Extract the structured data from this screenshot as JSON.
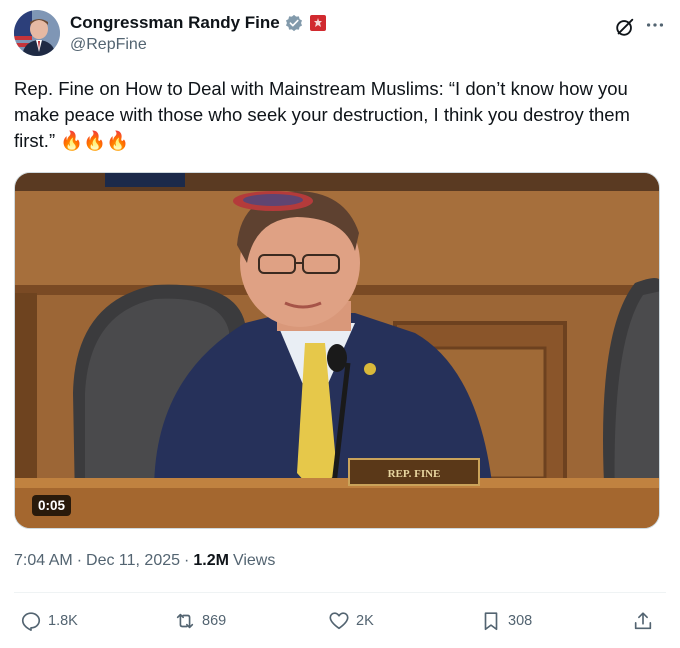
{
  "author": {
    "display_name": "Congressman Randy Fine",
    "handle": "@RepFine"
  },
  "icons": {
    "verified": "verified-badge-icon",
    "affiliate": "house-seal-icon",
    "grok": "grok-icon",
    "more": "more-options-icon"
  },
  "tweet": {
    "text": "Rep. Fine on How to Deal with Mainstream Muslims: “I don’t know how you make peace with those who seek your destruction, I think you destroy them first.” 🔥🔥🔥"
  },
  "media": {
    "nameplate": "REP. FINE",
    "duration": "0:05"
  },
  "meta": {
    "time": "7:04 AM",
    "date": "Dec 11, 2025",
    "views_count": "1.2M",
    "views_label": "Views",
    "separator": "·"
  },
  "actions": {
    "replies": "1.8K",
    "reposts": "869",
    "likes": "2K",
    "bookmarks": "308"
  },
  "colors": {
    "text_primary": "#0f1419",
    "text_secondary": "#536471",
    "verified_badge": "#829aab",
    "affiliate_badge": "#d12a2f"
  }
}
